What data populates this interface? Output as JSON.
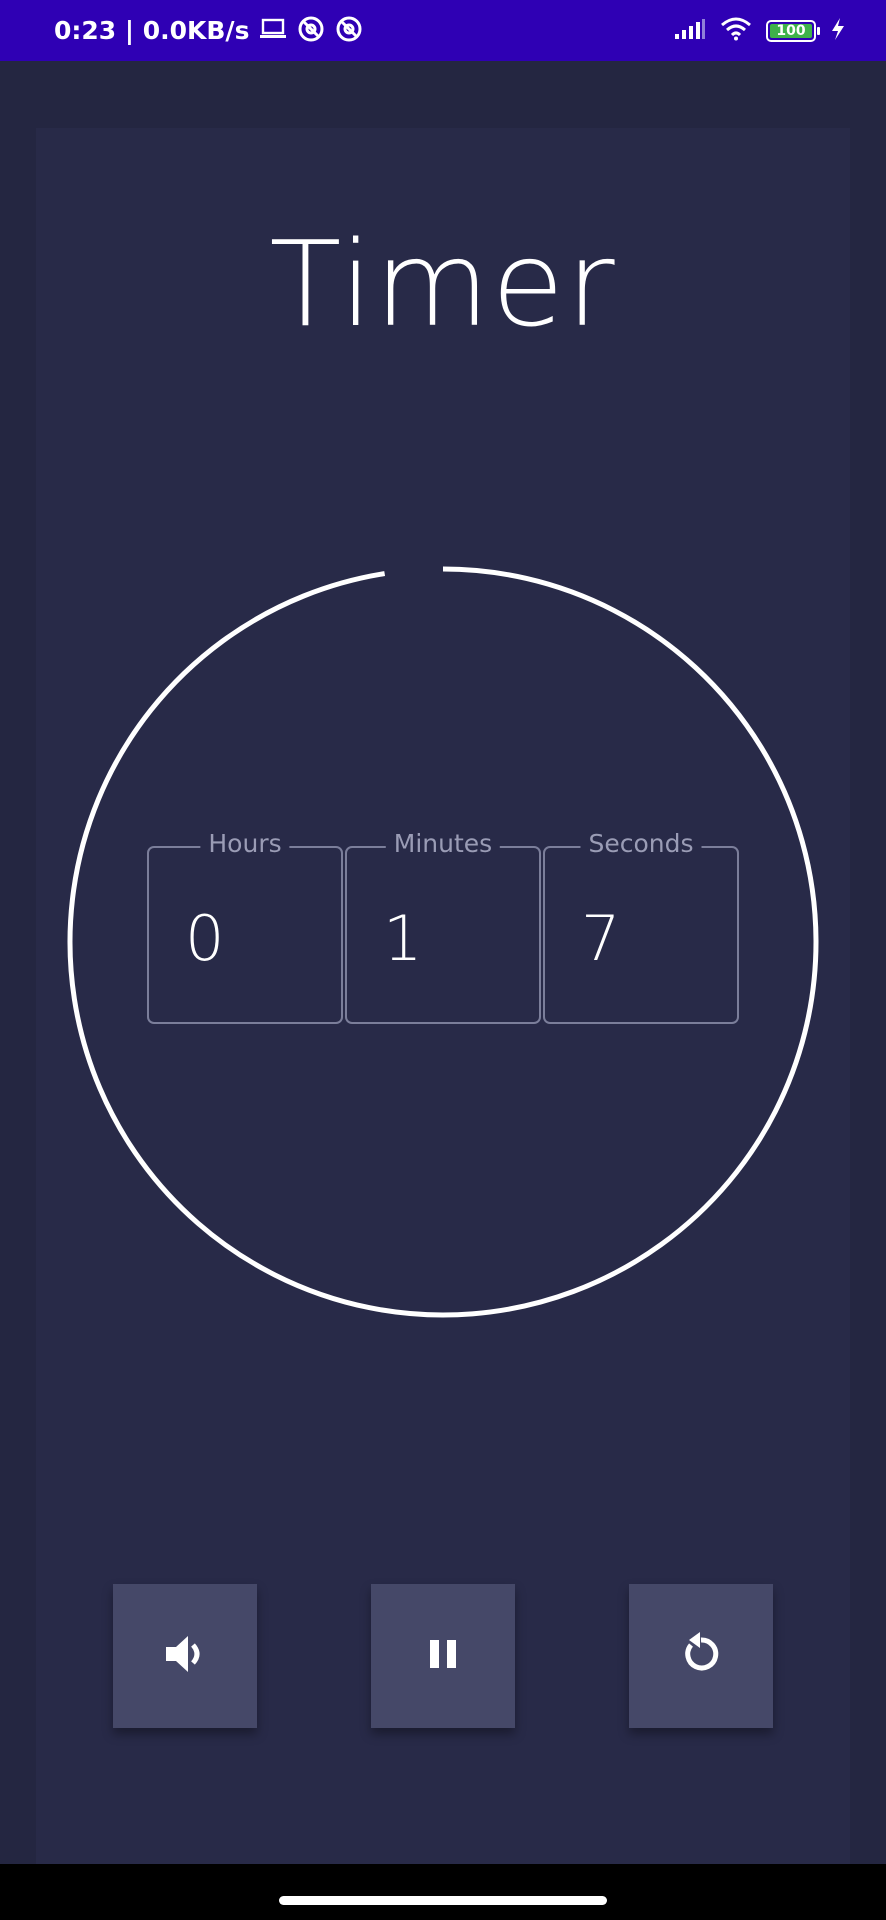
{
  "status_bar": {
    "time": "0:23 | 0.0KB/s",
    "battery": "100",
    "icons": [
      "laptop-icon",
      "app-notification-icon",
      "app-notification-icon",
      "signal-icon",
      "wifi-icon",
      "battery-icon",
      "charging-icon"
    ]
  },
  "app": {
    "title": "Timer"
  },
  "timer": {
    "hours_label": "Hours",
    "hours_value": "0",
    "minutes_label": "Minutes",
    "minutes_value": "1",
    "seconds_label": "Seconds",
    "seconds_value": "7",
    "progress_fraction": 0.975
  },
  "controls": {
    "sound_icon": "volume-icon",
    "pause_icon": "pause-icon",
    "reset_icon": "reset-icon"
  },
  "colors": {
    "status_bar": "#2f00b4",
    "background": "#242641",
    "card": "#282a48",
    "button": "#454868",
    "ring": "#ffffff",
    "field_border": "#7b7e9a",
    "label": "#9a9cb5"
  }
}
